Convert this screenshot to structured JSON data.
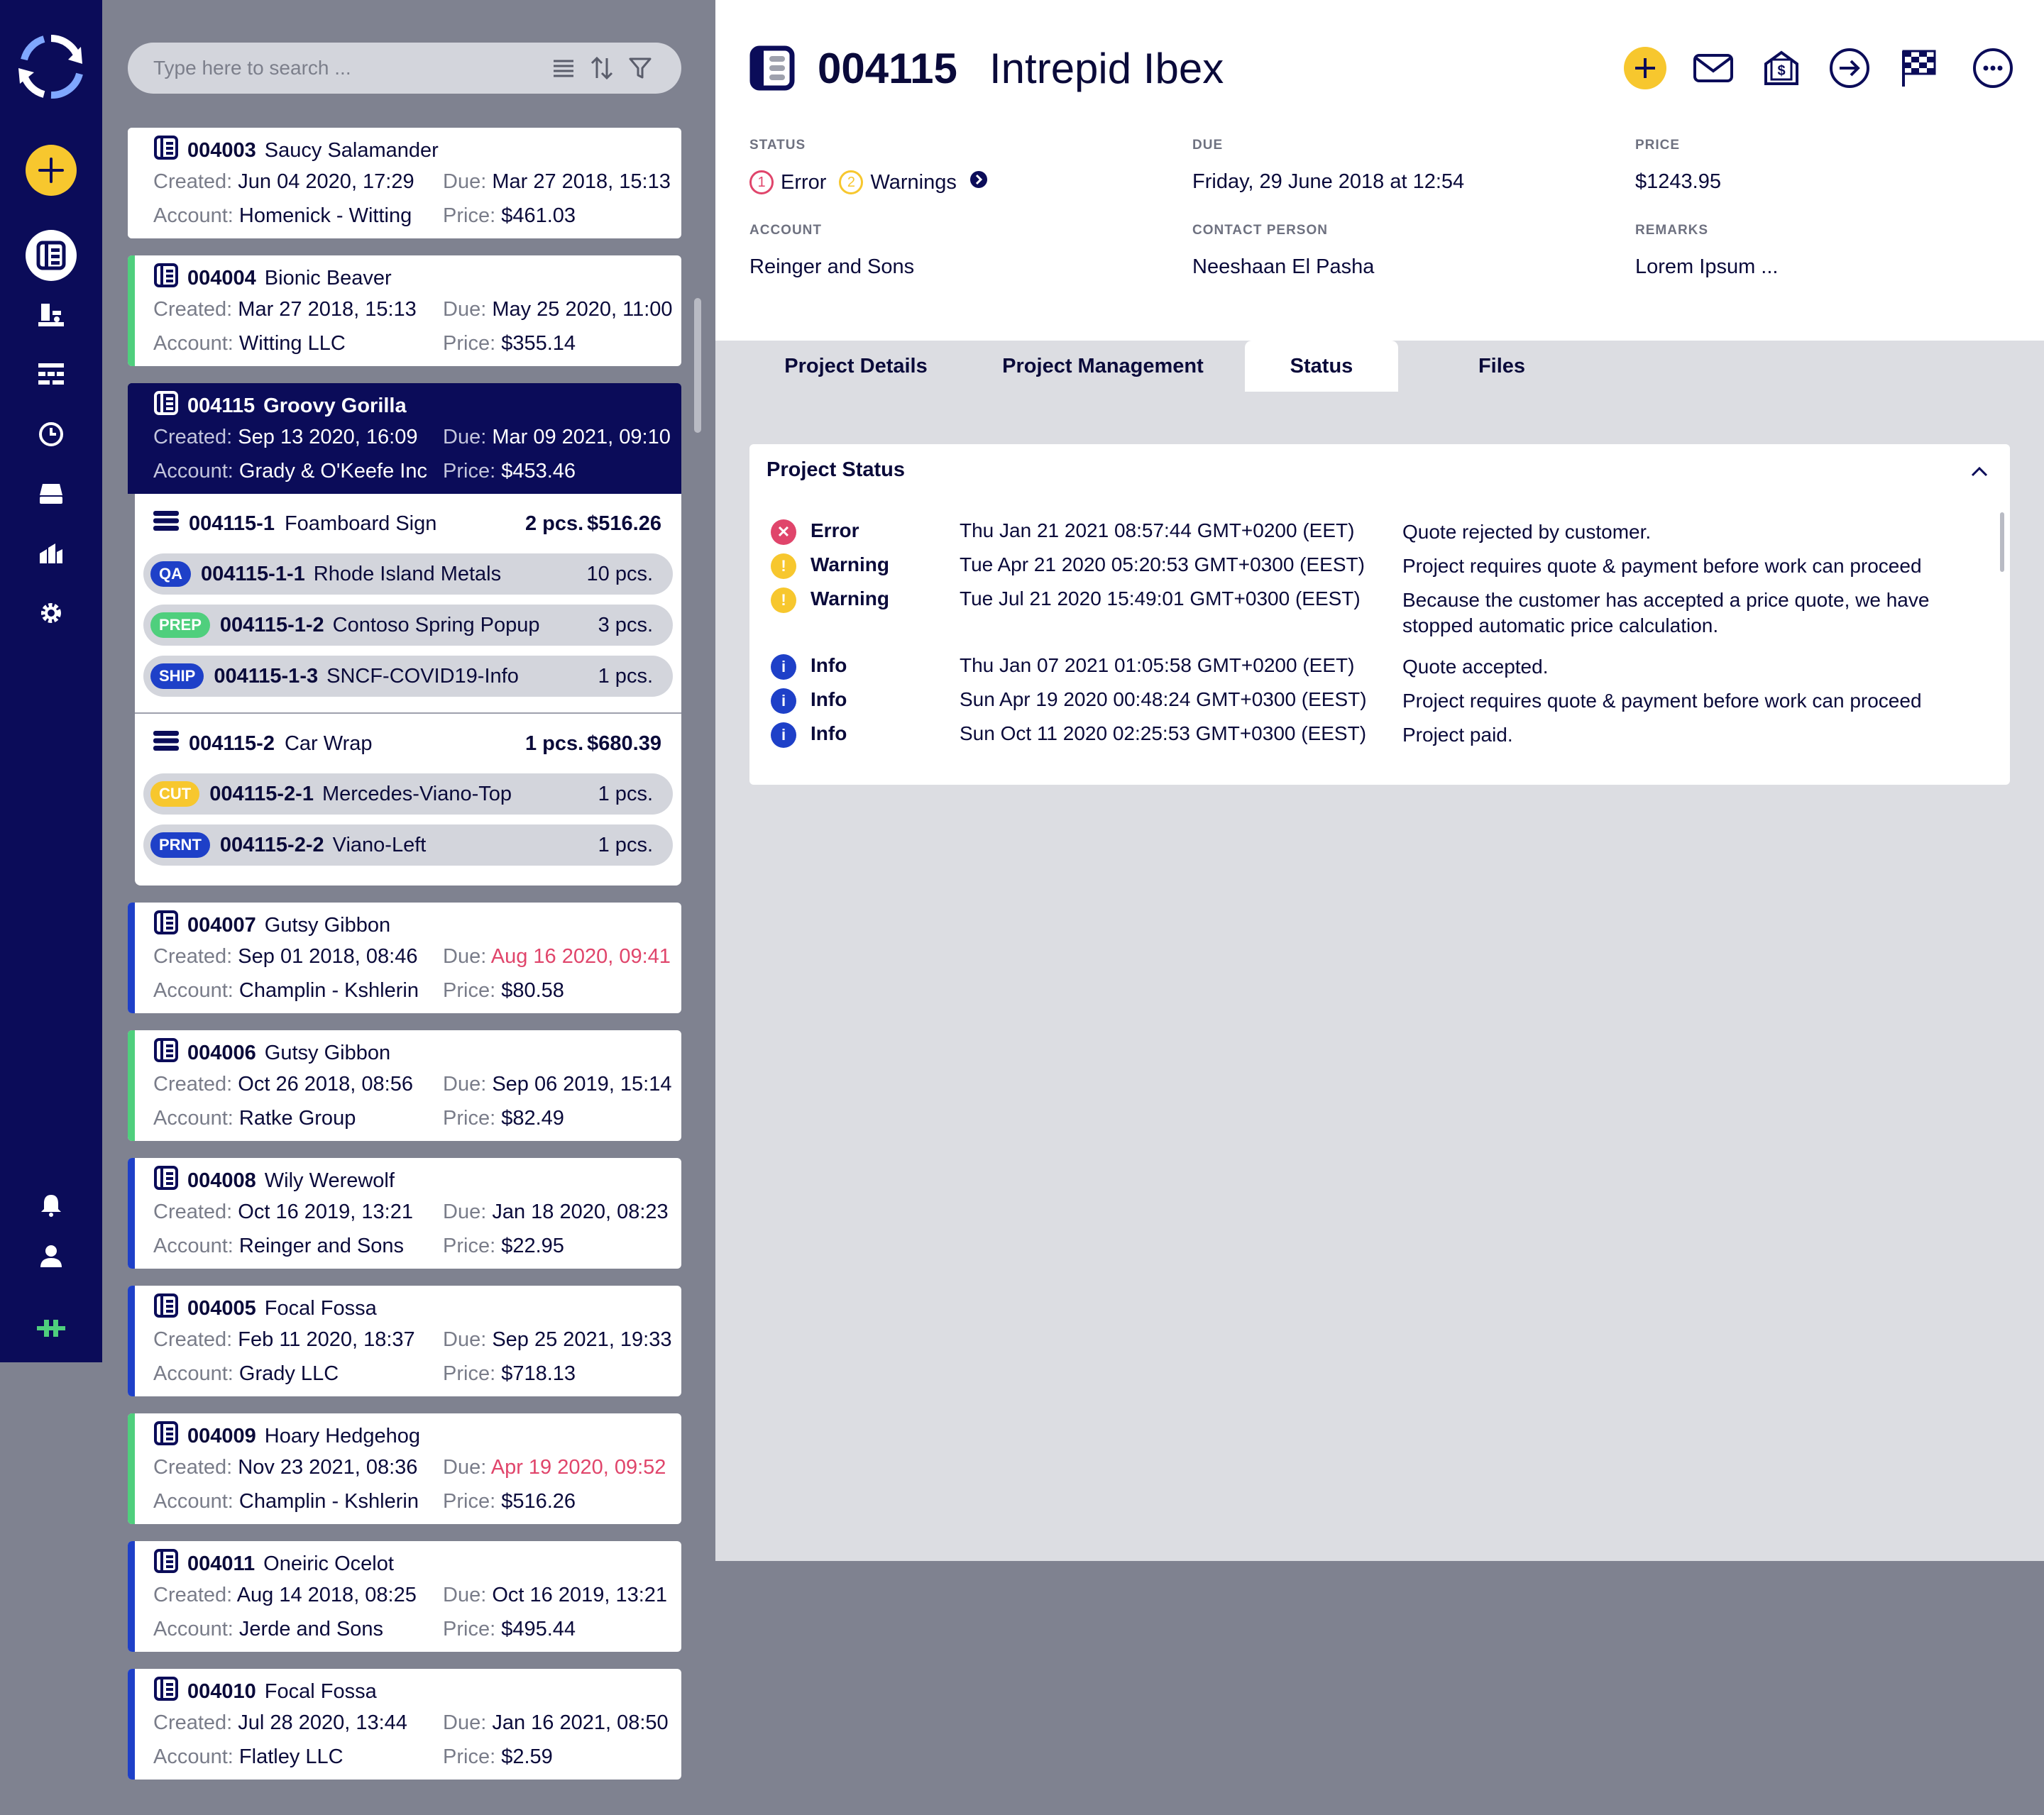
{
  "nav": {
    "items": [
      "projects",
      "production",
      "planning",
      "time",
      "printers",
      "reports",
      "settings"
    ],
    "bottom": [
      "notifications",
      "user",
      "connection"
    ]
  },
  "search": {
    "placeholder": "Type here to search ..."
  },
  "labels": {
    "created": "Created:",
    "due": "Due:",
    "account": "Account:",
    "price": "Price:"
  },
  "projects": [
    {
      "num": "004003",
      "name": "Saucy Salamander",
      "created": "Jun 04 2020, 17:29",
      "due": "Mar 27 2018, 15:13",
      "account": "Homenick - Witting",
      "price": "$461.03",
      "stripe": "#ffffff",
      "late": false
    },
    {
      "num": "004004",
      "name": "Bionic Beaver",
      "created": "Mar 27 2018, 15:13",
      "due": "May 25 2020, 11:00",
      "account": "Witting LLC",
      "price": "$355.14",
      "stripe": "#4fcf7d",
      "late": false
    },
    {
      "num": "004115",
      "name": "Groovy Gorilla",
      "created": "Sep 13 2020, 16:09",
      "due": "Mar 09 2021, 09:10",
      "account": "Grady & O'Keefe Inc",
      "price": "$453.46",
      "stripe": "#0b0c59",
      "late": false
    },
    {
      "num": "004007",
      "name": "Gutsy Gibbon",
      "created": "Sep 01 2018, 08:46",
      "due": "Aug 16 2020, 09:41",
      "account": "Champlin - Kshlerin",
      "price": "$80.58",
      "stripe": "#1e40c8",
      "late": true
    },
    {
      "num": "004006",
      "name": "Gutsy Gibbon",
      "created": "Oct 26 2018, 08:56",
      "due": "Sep 06 2019, 15:14",
      "account": "Ratke Group",
      "price": "$82.49",
      "stripe": "#4fcf7d",
      "late": false
    },
    {
      "num": "004008",
      "name": "Wily Werewolf",
      "created": "Oct 16 2019, 13:21",
      "due": "Jan 18 2020, 08:23",
      "account": "Reinger and Sons",
      "price": "$22.95",
      "stripe": "#1e40c8",
      "late": false
    },
    {
      "num": "004005",
      "name": "Focal Fossa",
      "created": "Feb 11 2020, 18:37",
      "due": "Sep 25 2021, 19:33",
      "account": "Grady LLC",
      "price": "$718.13",
      "stripe": "#1e40c8",
      "late": false
    },
    {
      "num": "004009",
      "name": "Hoary Hedgehog",
      "created": "Nov 23 2021, 08:36",
      "due": "Apr 19 2020, 09:52",
      "account": "Champlin - Kshlerin",
      "price": "$516.26",
      "stripe": "#4fcf7d",
      "late": true
    },
    {
      "num": "004011",
      "name": "Oneiric Ocelot",
      "created": "Aug 14 2018, 08:25",
      "due": "Oct 16 2019, 13:21",
      "account": "Jerde and Sons",
      "price": "$495.44",
      "stripe": "#1e40c8",
      "late": false
    },
    {
      "num": "004010",
      "name": "Focal Fossa",
      "created": "Jul 28 2020, 13:44",
      "due": "Jan 16 2021, 08:50",
      "account": "Flatley LLC",
      "price": "$2.59",
      "stripe": "#1e40c8",
      "late": false
    }
  ],
  "subprojects": [
    {
      "num": "004115-1",
      "name": "Foamboard Sign",
      "qty": "2 pcs.",
      "price": "$516.26",
      "jobs": [
        {
          "badge": "QA",
          "badge_color": "#1e40c8",
          "num": "004115-1-1",
          "name": "Rhode Island Metals",
          "qty": "10 pcs."
        },
        {
          "badge": "PREP",
          "badge_color": "#4fcf7d",
          "num": "004115-1-2",
          "name": "Contoso Spring Popup",
          "qty": "3 pcs."
        },
        {
          "badge": "SHIP",
          "badge_color": "#1e40c8",
          "num": "004115-1-3",
          "name": "SNCF-COVID19-Info",
          "qty": "1 pcs."
        }
      ]
    },
    {
      "num": "004115-2",
      "name": "Car Wrap",
      "qty": "1 pcs.",
      "price": "$680.39",
      "jobs": [
        {
          "badge": "CUT",
          "badge_color": "#f7c72e",
          "num": "004115-2-1",
          "name": "Mercedes-Viano-Top",
          "qty": "1 pcs."
        },
        {
          "badge": "PRNT",
          "badge_color": "#1e40c8",
          "num": "004115-2-2",
          "name": "Viano-Left",
          "qty": "1 pcs."
        }
      ]
    }
  ],
  "detail": {
    "num": "004115",
    "name": "Intrepid Ibex",
    "actions": [
      "add",
      "mail",
      "invoice",
      "forward",
      "finish",
      "more"
    ],
    "status_label": "STATUS",
    "status_error_count": "1",
    "status_error_text": "Error",
    "status_warning_count": "2",
    "status_warning_text": "Warnings",
    "due_label": "DUE",
    "due_value": "Friday, 29 June 2018 at 12:54",
    "price_label": "PRICE",
    "price_value": "$1243.95",
    "account_label": "ACCOUNT",
    "account_value": "Reinger and Sons",
    "contact_label": "CONTACT PERSON",
    "contact_value": "Neeshaan El Pasha",
    "remarks_label": "REMARKS",
    "remarks_value": "Lorem Ipsum ..."
  },
  "tabs": [
    "Project Details",
    "Project Management",
    "Status",
    "Files"
  ],
  "active_tab": "Status",
  "status_panel": {
    "title": "Project Status",
    "entries": [
      {
        "level": "Error",
        "icon": "error-icon",
        "color": "#e0456b",
        "date": "Thu Jan 21 2021 08:57:44 GMT+0200 (EET)",
        "message": "Quote rejected by customer."
      },
      {
        "level": "Warning",
        "icon": "warning-icon",
        "color": "#f7c72e",
        "date": "Tue Apr 21 2020 05:20:53 GMT+0300 (EEST)",
        "message": "Project requires quote & payment before work can proceed"
      },
      {
        "level": "Warning",
        "icon": "warning-icon",
        "color": "#f7c72e",
        "date": "Tue Jul 21 2020 15:49:01 GMT+0300 (EEST)",
        "message": "Because the customer has accepted a price quote, we have stopped automatic price calculation."
      },
      {
        "level": "Info",
        "icon": "info-icon",
        "color": "#1e40c8",
        "date": "Thu Jan 07 2021 01:05:58 GMT+0200 (EET)",
        "message": "Quote accepted."
      },
      {
        "level": "Info",
        "icon": "info-icon",
        "color": "#1e40c8",
        "date": "Sun Apr 19 2020 00:48:24 GMT+0300 (EEST)",
        "message": "Project requires quote & payment before work can proceed"
      },
      {
        "level": "Info",
        "icon": "info-icon",
        "color": "#1e40c8",
        "date": "Sun Oct 11 2020 02:25:53 GMT+0300 (EEST)",
        "message": "Project paid."
      }
    ]
  },
  "colors": {
    "navy": "#0b0c59",
    "accent": "#f7c72e",
    "error": "#e0456b",
    "info": "#1e40c8",
    "success": "#4fcf7d"
  }
}
